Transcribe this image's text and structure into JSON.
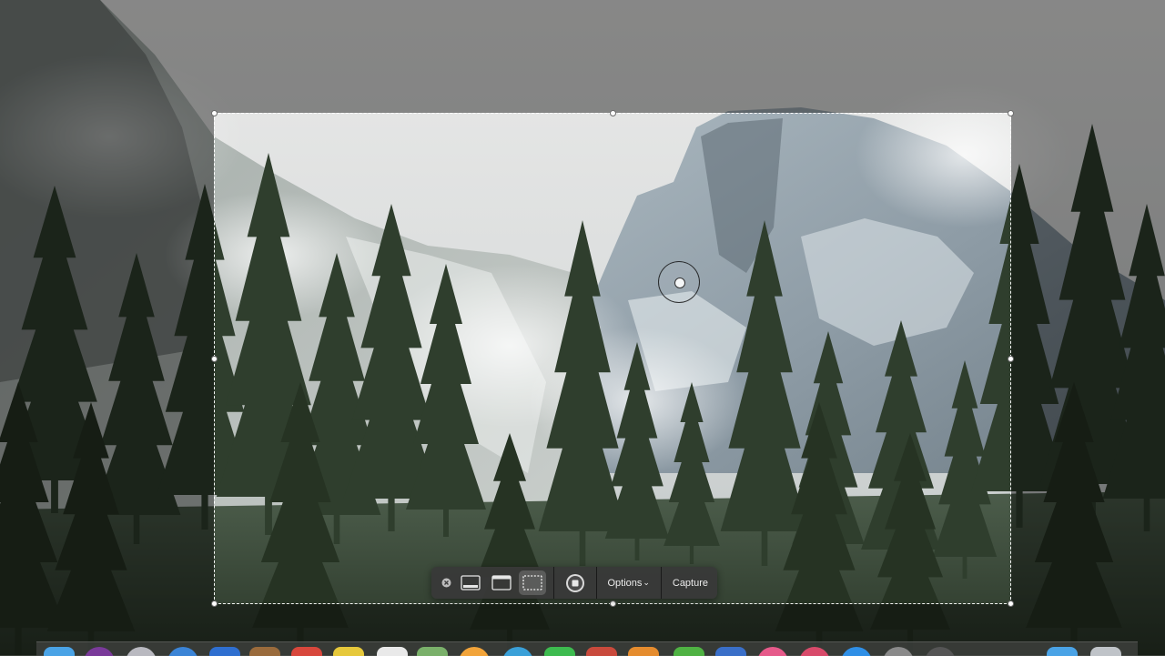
{
  "screen": {
    "wallpaper": "Yosemite valley with Half Dome, fog and pine forest",
    "dim_color": "#000000"
  },
  "capture_toolbar": {
    "close_icon": "close-circle-icon",
    "capture_entire_screen_icon": "entire-screen-icon",
    "capture_window_icon": "window-icon",
    "capture_selection_icon": "selection-icon",
    "record_icon": "record-stop-icon",
    "options_label": "Options",
    "options_chevron": "⌄",
    "capture_label": "Capture",
    "active_mode": "selection"
  },
  "cursor": {
    "icon": "crosshair-camera-icon"
  },
  "dock": {
    "icons": [
      {
        "name": "finder-icon",
        "color": "#4aa3e6"
      },
      {
        "name": "siri-icon",
        "color": "#7a3a9a"
      },
      {
        "name": "launchpad-icon",
        "color": "#b9b9c0"
      },
      {
        "name": "safari-icon",
        "color": "#3b84d6"
      },
      {
        "name": "mail-icon",
        "color": "#2f6fd0"
      },
      {
        "name": "contacts-icon",
        "color": "#9a6b3c"
      },
      {
        "name": "calendar-icon",
        "color": "#d8473c"
      },
      {
        "name": "notes-icon",
        "color": "#e6c83b"
      },
      {
        "name": "reminders-icon",
        "color": "#e9e9e9"
      },
      {
        "name": "maps-icon",
        "color": "#7ab06a"
      },
      {
        "name": "photos-icon",
        "color": "#f2a43a"
      },
      {
        "name": "messages-icon",
        "color": "#3aa0d8"
      },
      {
        "name": "facetime-icon",
        "color": "#3dbb4f"
      },
      {
        "name": "photo-booth-icon",
        "color": "#c94a3c"
      },
      {
        "name": "ibooks-icon",
        "color": "#e58c2e"
      },
      {
        "name": "numbers-icon",
        "color": "#4fb243"
      },
      {
        "name": "keynote-icon",
        "color": "#3a6fc8"
      },
      {
        "name": "itunes-icon",
        "color": "#e65a8a"
      },
      {
        "name": "music-icon",
        "color": "#d84a6a"
      },
      {
        "name": "app-store-icon",
        "color": "#2f8fe6"
      },
      {
        "name": "preferences-icon",
        "color": "#8a8a8a"
      },
      {
        "name": "sound-icon",
        "color": "#555555"
      },
      {
        "name": "folder-icon",
        "color": "#4aa3e6"
      },
      {
        "name": "trash-icon",
        "color": "#bfc3c8"
      }
    ]
  }
}
